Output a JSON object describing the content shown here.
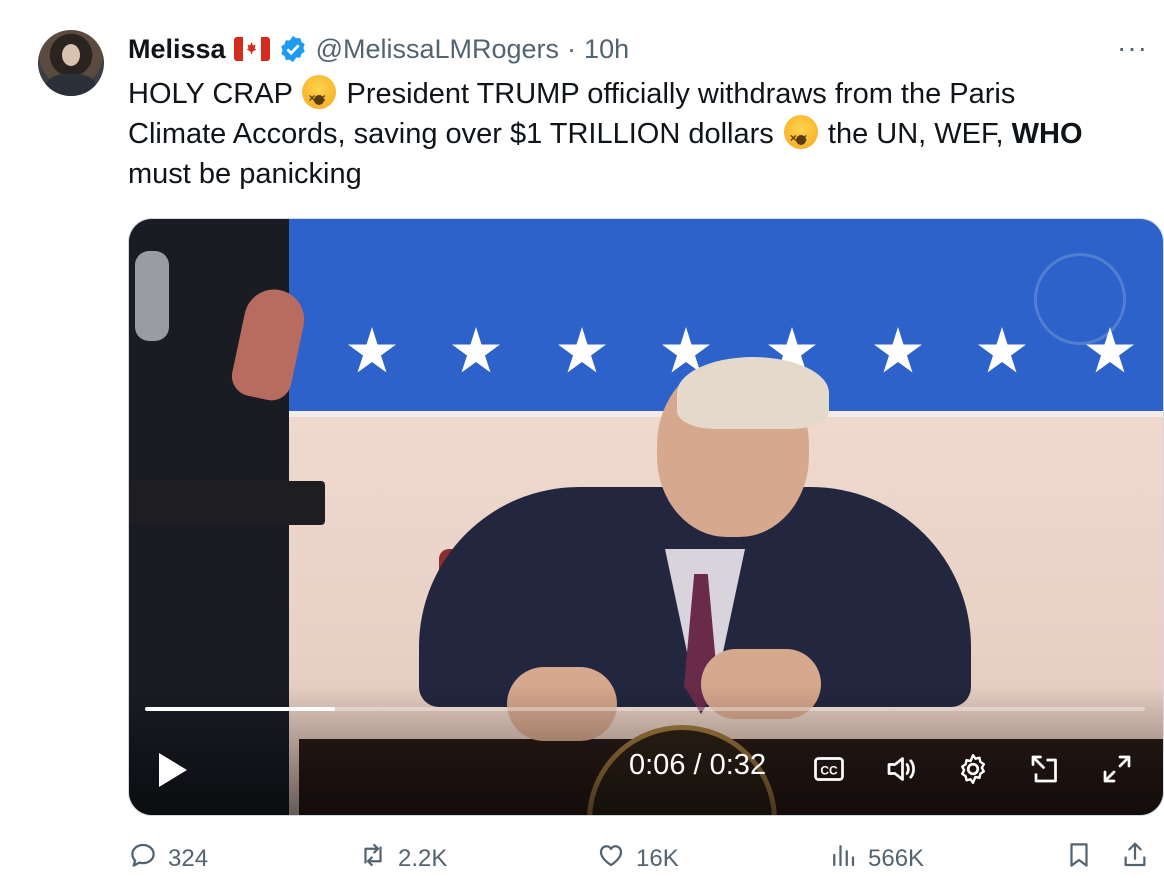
{
  "author": {
    "name": "Melissa",
    "handle": "@MelissaLMRogers",
    "separator": "·",
    "time": "10h",
    "flag": "canada-flag",
    "verified_icon": "verified-badge-icon",
    "verified_color": "#1d9bf0"
  },
  "more_icon": "more-icon",
  "more_label": "···",
  "tweet": {
    "line1_a": "HOLY CRAP",
    "line1_b": " President TRUMP officially withdraws from the Paris",
    "line2_a": "Climate Accords, saving over $1 TRILLION dollars",
    "line2_b": " the UN, WEF, ",
    "line2_bold": "WHO",
    "line3": "must be panicking",
    "emoji": "dizzy-face-emoji"
  },
  "video": {
    "current_time": "0:06",
    "separator": " / ",
    "duration": "0:32",
    "progress": 0.19,
    "controls": [
      "play-icon",
      "cc-icon",
      "volume-icon",
      "settings-icon",
      "pop-out-icon",
      "fullscreen-icon"
    ]
  },
  "actions": {
    "replies": "324",
    "reposts": "2.2K",
    "likes": "16K",
    "views": "566K",
    "icons": [
      "reply-icon",
      "repost-icon",
      "like-icon",
      "views-icon",
      "bookmark-icon",
      "share-icon"
    ]
  },
  "colors": {
    "text": "#0f1419",
    "muted": "#536471",
    "accent": "#1d9bf0"
  }
}
